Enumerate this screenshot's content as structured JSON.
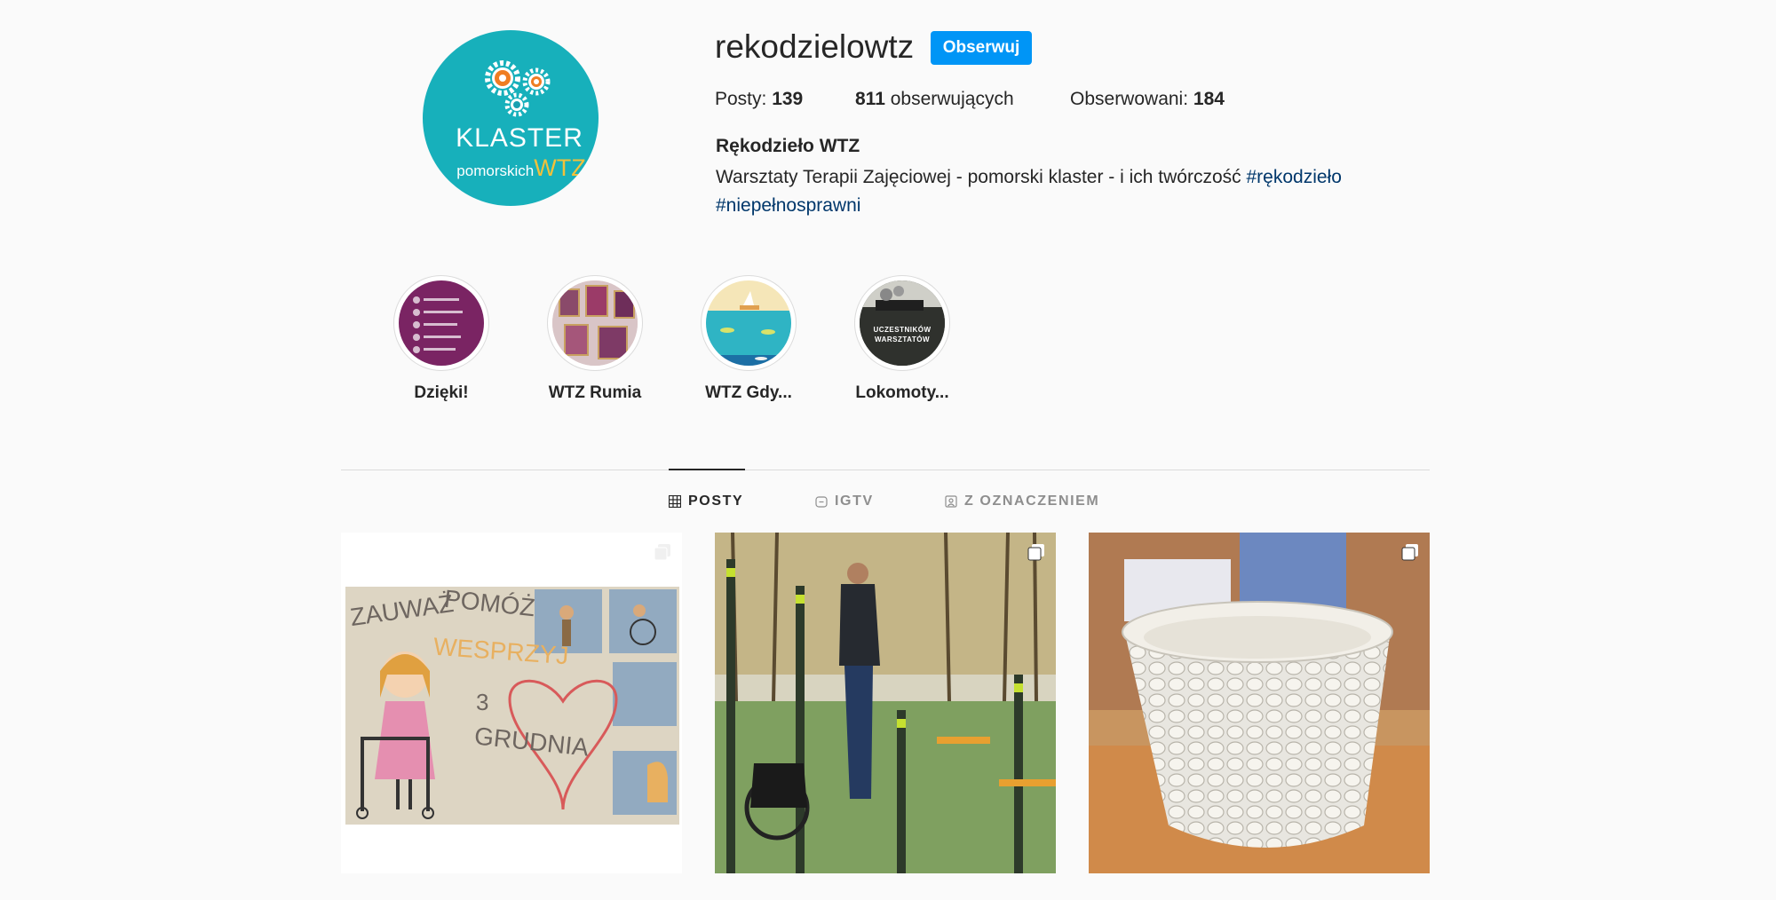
{
  "profile": {
    "logo_line1": "KLASTER",
    "logo_line2": "pomorskich",
    "logo_line2_accent": "WTZ",
    "username": "rekodzielowtz",
    "follow_label": "Obserwuj",
    "posts_label": "Posty:",
    "posts_count": "139",
    "followers_count": "811",
    "followers_label": "obserwujących",
    "following_label": "Obserwowani:",
    "following_count": "184",
    "full_name": "Rękodzieło WTZ",
    "bio": "Warsztaty Terapii Zajęciowej - pomorski klaster - i ich twórczość",
    "hashtag1": "#rękodzieło",
    "hashtag2": "#niepełnosprawni"
  },
  "highlights": [
    {
      "label": "Dzięki!"
    },
    {
      "label": "WTZ Rumia"
    },
    {
      "label": "WTZ Gdy..."
    },
    {
      "label": "Lokomoty..."
    }
  ],
  "tabs": [
    {
      "label": "POSTY",
      "icon": "grid-icon"
    },
    {
      "label": "IGTV",
      "icon": "igtv-icon"
    },
    {
      "label": "Z OZNACZENIEM",
      "icon": "tagged-icon"
    }
  ],
  "highlight_lokomotywa_text": "UCZESTNIKÓW WARSZTATÓW",
  "posts_drawing_text": [
    "ZAUWAŻ",
    "POMÓŻ",
    "WESPRZYJ",
    "3",
    "GRUDNIA"
  ],
  "colors": {
    "accent": "#0095f6",
    "logo_bg": "#17b0bb",
    "hashtag": "#00376b"
  }
}
